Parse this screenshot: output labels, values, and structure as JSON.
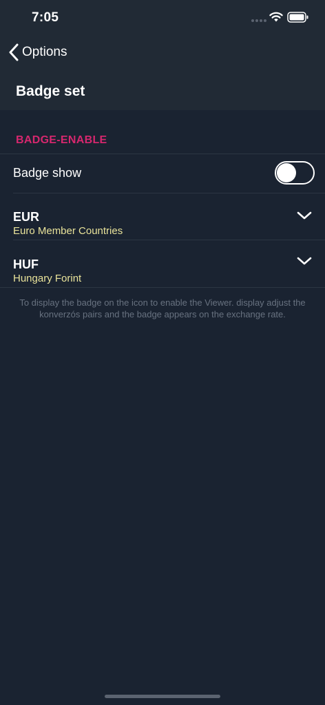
{
  "status_bar": {
    "time": "7:05"
  },
  "nav": {
    "back_label": "Options",
    "title": "Badge set"
  },
  "section": {
    "header": "BADGE-ENABLE",
    "accent_color": "#d6276e"
  },
  "badge_toggle": {
    "label": "Badge show",
    "enabled": false
  },
  "currencies": [
    {
      "code": "EUR",
      "name": "Euro Member Countries"
    },
    {
      "code": "HUF",
      "name": "Hungary Forint"
    }
  ],
  "footer_note": "To display the badge on the icon to enable the Viewer. display adjust the konverzós pairs and the badge appears on the exchange rate.",
  "icons": {
    "back": "chevron-left-icon",
    "dropdown": "chevron-down-icon",
    "wifi": "wifi-icon",
    "battery": "battery-icon"
  }
}
